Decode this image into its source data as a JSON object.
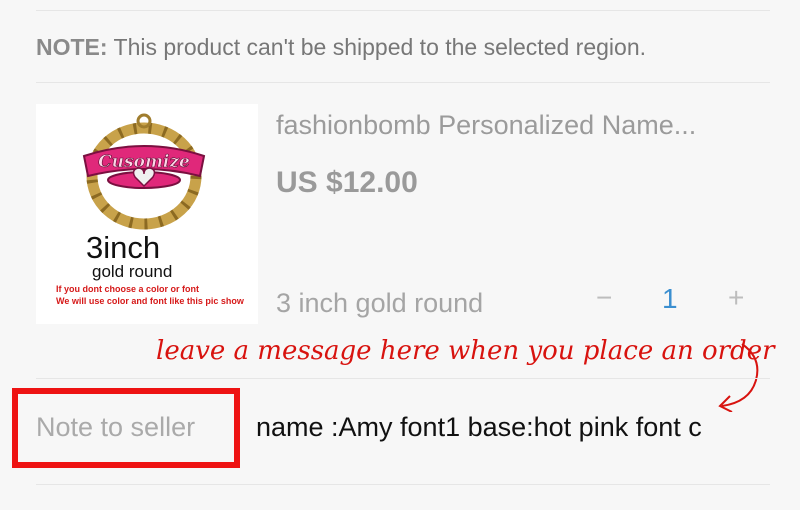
{
  "notice": {
    "label": "NOTE:",
    "text": "This product can't be shipped to the selected region."
  },
  "product": {
    "title": "fashionbomb Personalized Name...",
    "price": "US $12.00",
    "variant": "3 inch gold round",
    "image": {
      "logo_text": "Cusomize",
      "size_text": "3inch",
      "sub_text": "gold round",
      "note_line1": "If you dont choose a color or font",
      "note_line2": "We will use color and font like this pic show"
    }
  },
  "quantity": {
    "minus_label": "−",
    "value": "1",
    "plus_label": "+"
  },
  "annotation": {
    "text": "leave a message here when you place an order"
  },
  "seller_note": {
    "label": "Note to seller",
    "value": "name :Amy  font1 base:hot pink font c"
  },
  "colors": {
    "accent_blue": "#3b8fd0",
    "highlight_red": "#ee1313",
    "annotation_red": "#d8130f",
    "hoop_gold": "#c8a24a",
    "hoop_pink": "#e0287a"
  }
}
